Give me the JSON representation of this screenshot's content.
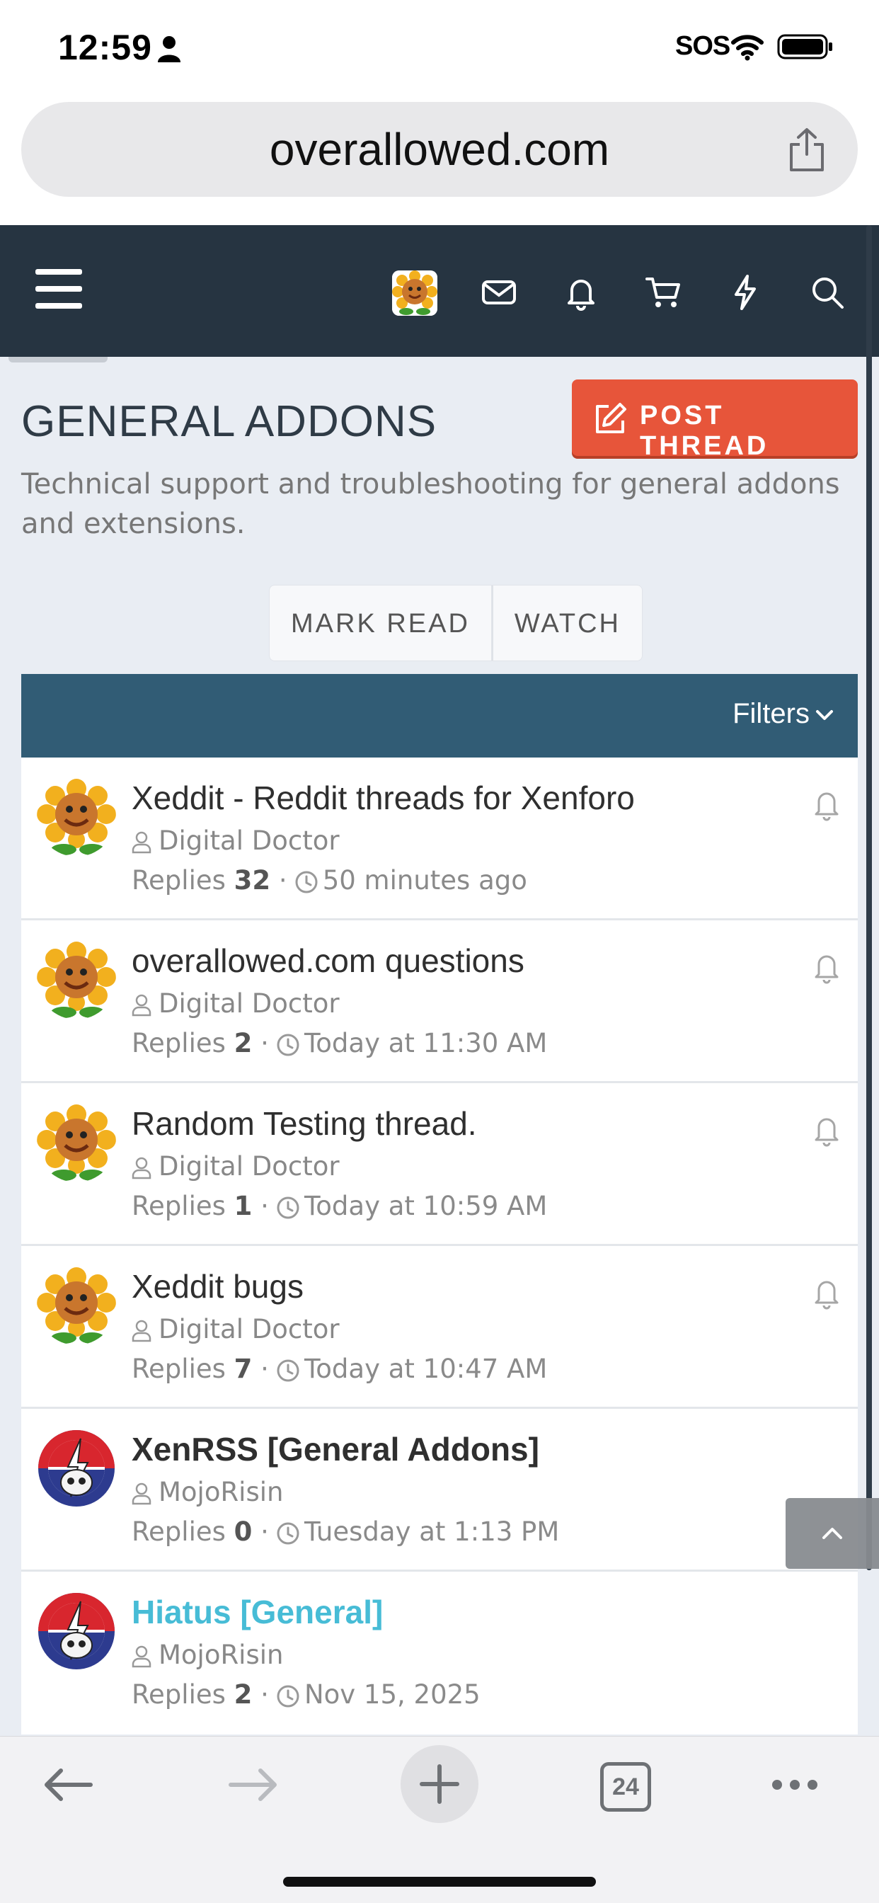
{
  "status_bar": {
    "time": "12:59",
    "sos": "SOS"
  },
  "browser": {
    "url": "overallowed.com"
  },
  "forum": {
    "title": "GENERAL ADDONS",
    "post_thread_label": "POST THREAD",
    "description": "Technical support and troubleshooting for general addons and extensions.",
    "mark_read_label": "MARK READ",
    "watch_label": "WATCH",
    "filters_label": "Filters"
  },
  "threads": [
    {
      "title": "Xeddit - Reddit threads for Xenforo",
      "author": "Digital Doctor",
      "replies_label": "Replies",
      "replies": "32",
      "time": "50 minutes ago",
      "avatar": "sunflower"
    },
    {
      "title": "overallowed.com questions",
      "author": "Digital Doctor",
      "replies_label": "Replies",
      "replies": "2",
      "time": "Today at 11:30 AM",
      "avatar": "sunflower"
    },
    {
      "title": "Random Testing thread.",
      "author": "Digital Doctor",
      "replies_label": "Replies",
      "replies": "1",
      "time": "Today at 10:59 AM",
      "avatar": "sunflower"
    },
    {
      "title": "Xeddit bugs",
      "author": "Digital Doctor",
      "replies_label": "Replies",
      "replies": "7",
      "time": "Today at 10:47 AM",
      "avatar": "sunflower"
    },
    {
      "title": "XenRSS [General Addons]",
      "author": "MojoRisin",
      "replies_label": "Replies",
      "replies": "0",
      "time": "Tuesday at 1:13 PM",
      "avatar": "steal-your-face"
    },
    {
      "title": "Hiatus [General]",
      "author": "MojoRisin",
      "replies_label": "Replies",
      "replies": "2",
      "time": "Nov 15, 2025",
      "avatar": "steal-your-face"
    }
  ],
  "toolbar": {
    "tab_count": "24"
  },
  "colors": {
    "header_bg": "#263441",
    "accent": "#e7553a",
    "filter_bar": "#315c75",
    "link": "#47bcd6"
  }
}
